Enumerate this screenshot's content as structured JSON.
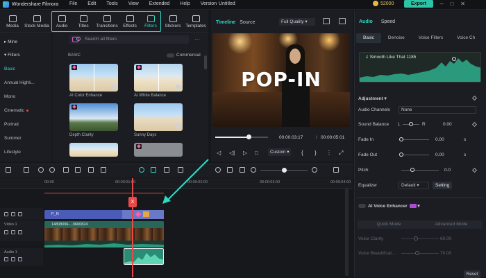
{
  "app": {
    "name": "Wondershare Filmora",
    "project": "Untitled",
    "coins": "52000",
    "export_label": "Export"
  },
  "menu": [
    "File",
    "Edit",
    "Tools",
    "View",
    "Extended",
    "Help",
    "Version"
  ],
  "toolbar": [
    {
      "label": "Media",
      "icon": "media-icon"
    },
    {
      "label": "Stock Media",
      "icon": "stock-media-icon"
    },
    {
      "label": "Audio",
      "icon": "audio-icon"
    },
    {
      "label": "Titles",
      "icon": "titles-icon"
    },
    {
      "label": "Transitions",
      "icon": "transitions-icon"
    },
    {
      "label": "Effects",
      "icon": "effects-icon"
    },
    {
      "label": "Filters",
      "icon": "filters-icon"
    },
    {
      "label": "Stickers",
      "icon": "stickers-icon"
    },
    {
      "label": "Templates",
      "icon": "templates-icon"
    }
  ],
  "sidebar": {
    "mine": "Mine",
    "filters": "Filters",
    "items": [
      "Basic",
      "Annual Highli...",
      "Mono",
      "Cinematic",
      "Portrait",
      "Summer",
      "Lifestyle"
    ]
  },
  "filters": {
    "search_placeholder": "Search all filters",
    "section": "BASIC",
    "commercial": "Commercial",
    "items": [
      {
        "label": "AI Color Enhance"
      },
      {
        "label": "AI White Balance"
      },
      {
        "label": "Depth Clarity"
      },
      {
        "label": "Sunny Days"
      }
    ]
  },
  "player": {
    "tabs": [
      "Timeline",
      "Source"
    ],
    "quality": "Full Quality",
    "overlay_text": "POP-IN",
    "current_time": "00:00:03:17",
    "total_time": "00:00:05:01",
    "zoom": "Custom",
    "progress": 0.63
  },
  "right": {
    "tabs": [
      "Audio",
      "Speed"
    ],
    "subtabs": [
      "Basic",
      "Denoise",
      "Voice Filters",
      "Voice Ch"
    ],
    "track_name": "Smooth Like That 1185",
    "adjustment": "Adjustment",
    "rows": [
      {
        "label": "Audio Channels",
        "value": "None"
      },
      {
        "label": "Sound Balance",
        "left": "L",
        "right": "R",
        "value": "0.00"
      },
      {
        "label": "Fade In",
        "value": "0.00",
        "unit": "s"
      },
      {
        "label": "Fade Out",
        "value": "0.00",
        "unit": "s"
      },
      {
        "label": "Pitch",
        "value": "0.0"
      },
      {
        "label": "Equalizer",
        "value": "Default",
        "button": "Setting"
      }
    ],
    "ai_voice": "AI Voice Enhancer",
    "enh_tabs": [
      "Quick Mode",
      "Advanced Mode"
    ],
    "voice_clarity": "Voice Clarity",
    "voice_clarity_val": "60.00",
    "voice_beautify": "Voice Beautificat...",
    "voice_beautify_val": "70.00",
    "reset": "Reset"
  },
  "timeline": {
    "ruler": [
      "00:00",
      "00:00:01:00",
      "00:00:02:00",
      "00:00:03:00",
      "00:00:04:00"
    ],
    "tracks": {
      "fx_label": "P_N",
      "video_label": "Video 1",
      "video_clip": "14808096-...0660824",
      "audio_label": "Audio 1"
    },
    "playhead_label": "X"
  },
  "colors": {
    "accent": "#2fd8c2",
    "playhead": "#e84a4a",
    "export": "#2cc3a6"
  }
}
